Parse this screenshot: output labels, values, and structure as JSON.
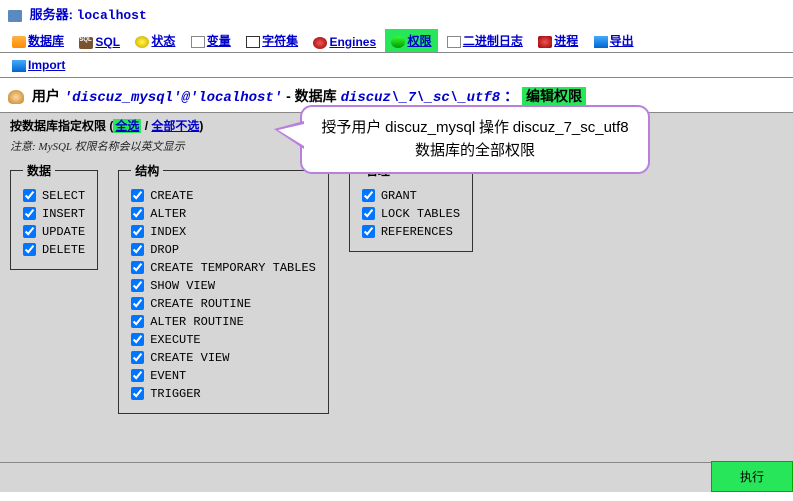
{
  "server": {
    "label": "服务器: ",
    "host": "localhost"
  },
  "tabs": {
    "db": "数据库",
    "sql": "SQL",
    "status": "状态",
    "vars": "变量",
    "charset": "字符集",
    "engines": "Engines",
    "priv": "权限",
    "binlog": "二进制日志",
    "proc": "进程",
    "export": "导出",
    "import": "Import"
  },
  "user_line": {
    "label": "用户",
    "user_quoted": "'discuz_mysql'@'localhost'",
    "dash": "-",
    "db_label": "数据库",
    "db_name": "discuz\\_7\\_sc\\_utf8",
    "colon": "：",
    "edit_priv": "编辑权限"
  },
  "selector": {
    "prefix": "按数据库指定权限",
    "open": "(",
    "select_all": "全选",
    "sep": " / ",
    "unselect_all": "全部不选",
    "close": ")"
  },
  "note": "注意: MySQL 权限名称会以英文显示",
  "groups": {
    "data": {
      "legend": "数据",
      "items": [
        "SELECT",
        "INSERT",
        "UPDATE",
        "DELETE"
      ]
    },
    "structure": {
      "legend": "结构",
      "items": [
        "CREATE",
        "ALTER",
        "INDEX",
        "DROP",
        "CREATE TEMPORARY TABLES",
        "SHOW VIEW",
        "CREATE ROUTINE",
        "ALTER ROUTINE",
        "EXECUTE",
        "CREATE VIEW",
        "EVENT",
        "TRIGGER"
      ]
    },
    "admin": {
      "legend": "管理",
      "items": [
        "GRANT",
        "LOCK TABLES",
        "REFERENCES"
      ]
    }
  },
  "callout": {
    "line1_a": "授予用户 ",
    "line1_b": "discuz_mysql",
    "line1_c": " 操作 ",
    "line1_d": "discuz_7_sc_utf8",
    "line2": "数据库的全部权限"
  },
  "exec": "执行"
}
